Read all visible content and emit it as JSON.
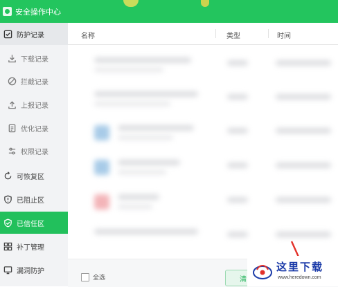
{
  "window": {
    "title": "安全操作中心"
  },
  "sidebar": {
    "items": [
      {
        "label": "防护记录",
        "icon": "checklist-icon",
        "kind": "parent"
      },
      {
        "label": "下载记录",
        "icon": "download-icon",
        "kind": "sub"
      },
      {
        "label": "拦截记录",
        "icon": "block-icon",
        "kind": "sub"
      },
      {
        "label": "上报记录",
        "icon": "upload-icon",
        "kind": "sub"
      },
      {
        "label": "优化记录",
        "icon": "document-icon",
        "kind": "sub"
      },
      {
        "label": "权限记录",
        "icon": "sliders-icon",
        "kind": "sub"
      },
      {
        "label": "可恢复区",
        "icon": "restore-icon",
        "kind": "top"
      },
      {
        "label": "已阻止区",
        "icon": "shield-alert-icon",
        "kind": "top"
      },
      {
        "label": "已信任区",
        "icon": "shield-check-icon",
        "kind": "active"
      },
      {
        "label": "补丁管理",
        "icon": "patch-grid-icon",
        "kind": "top"
      },
      {
        "label": "漏洞防护",
        "icon": "monitor-icon",
        "kind": "top"
      }
    ]
  },
  "table": {
    "columns": [
      "名称",
      "类型",
      "时间"
    ],
    "rows": [
      {
        "icon_color": ""
      },
      {
        "icon_color": ""
      },
      {
        "icon_color": "#a8cbe8"
      },
      {
        "icon_color": "#a8cbe8"
      },
      {
        "icon_color": "#f3b4b8"
      },
      {
        "icon_color": ""
      }
    ]
  },
  "footer": {
    "select_all": "全选",
    "action_button": "清"
  },
  "watermark": {
    "text": "这里下载",
    "url": "www.heredown.com"
  },
  "colors": {
    "accent": "#23c55e",
    "sidebar_bg": "#f2f3f5",
    "active_bg": "#22c05c"
  }
}
